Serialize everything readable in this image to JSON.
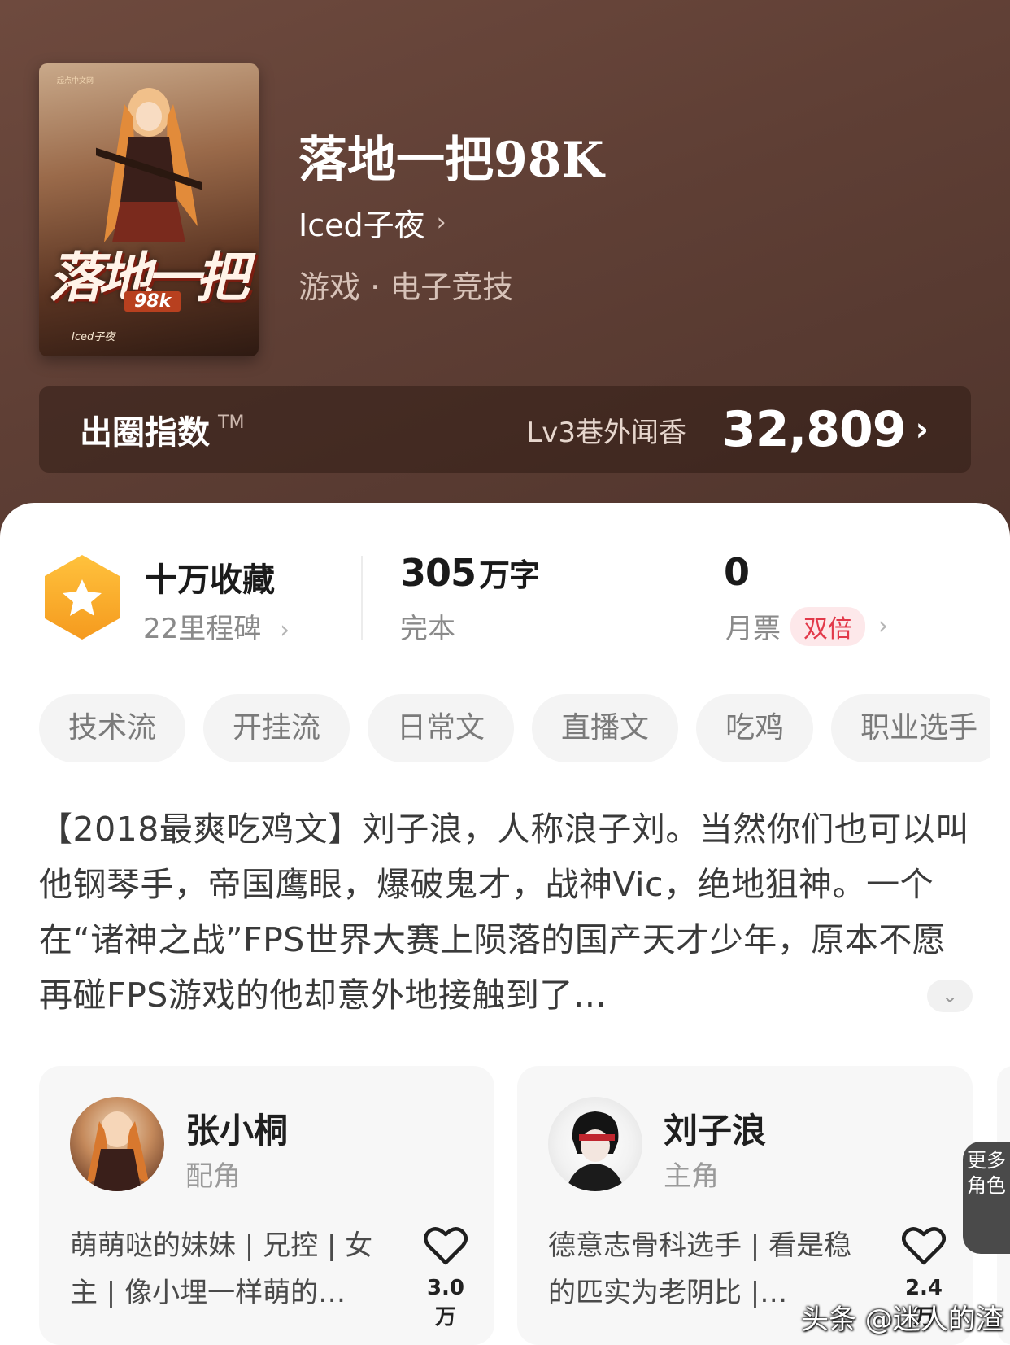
{
  "book": {
    "title": "落地一把98K",
    "author": "Iced子夜",
    "genre": "游戏 · 电子竞技",
    "cover": {
      "title": "落地一把",
      "badge": "98k",
      "author": "Iced子夜",
      "publisher": "起点中文网"
    }
  },
  "index": {
    "label": "出圈指数",
    "tm": "TM",
    "level": "Lv3巷外闻香",
    "value": "32,809"
  },
  "stats": {
    "collect_title": "十万收藏",
    "collect_sub": "22里程碑",
    "words_value": "305",
    "words_unit": "万字",
    "status": "完本",
    "votes_value": "0",
    "votes_label": "月票",
    "votes_badge": "双倍"
  },
  "tags": [
    "技术流",
    "开挂流",
    "日常文",
    "直播文",
    "吃鸡",
    "职业选手"
  ],
  "synopsis": "【2018最爽吃鸡文】刘子浪，人称浪子刘。当然你们也可以叫他钢琴手，帝国鹰眼，爆破鬼才，战神Vic，绝地狙神。一个在“诸神之战”FPS世界大赛上陨落的国产天才少年，原本不愿再碰FPS游戏的他却意外地接触到了…",
  "characters": [
    {
      "name": "张小桐",
      "role": "配角",
      "desc": "萌萌哒的妹妹 | 兄控 | 女主 | 像小埋一样萌的…",
      "likes": "3.0万"
    },
    {
      "name": "刘子浪",
      "role": "主角",
      "desc": "德意志骨科选手 | 看是稳的匹实为老阴比 |…",
      "likes": "2.4万"
    }
  ],
  "more_roles": "更多角色",
  "watermark": "头条 @迷人的渣",
  "colors": {
    "hero_bg": "#5f3f35",
    "star_orange": "#f7a826",
    "badge_red": "#e2394a"
  }
}
